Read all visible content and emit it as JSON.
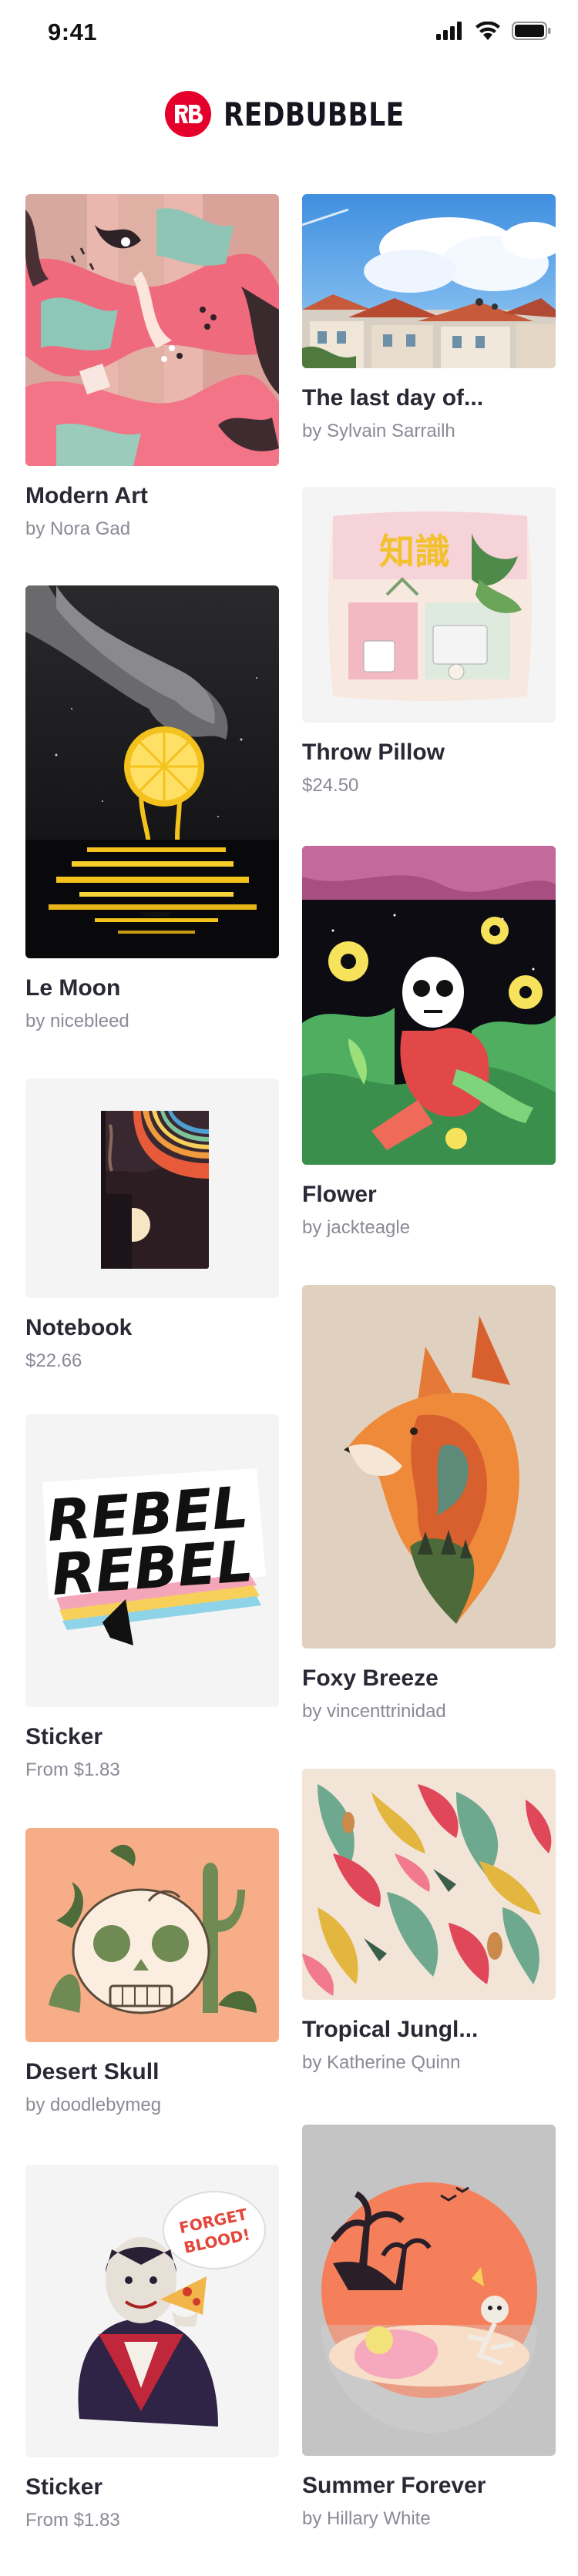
{
  "status_bar": {
    "time": "9:41"
  },
  "brand": {
    "name": "REDBUBBLE",
    "color": "#e4002b"
  },
  "cards": [
    {
      "title": "Modern Art",
      "subtitle": "by Nora Gad"
    },
    {
      "title": "The last day of...",
      "subtitle": "by Sylvain Sarrailh"
    },
    {
      "title": "Throw Pillow",
      "subtitle": "$24.50",
      "image_text": "知識"
    },
    {
      "title": "Le Moon",
      "subtitle": "by nicebleed"
    },
    {
      "title": "Flower",
      "subtitle": "by jackteagle"
    },
    {
      "title": "Notebook",
      "subtitle": "$22.66"
    },
    {
      "title": "Foxy Breeze",
      "subtitle": "by vincenttrinidad"
    },
    {
      "title": "Sticker",
      "subtitle": "From $1.83",
      "image_text": [
        "REBEL",
        "REBEL"
      ]
    },
    {
      "title": "Tropical Jungl...",
      "subtitle": "by Katherine Quinn"
    },
    {
      "title": "Desert Skull",
      "subtitle": "by doodlebymeg"
    },
    {
      "title": "Summer Forever",
      "subtitle": "by Hillary White"
    },
    {
      "title": "Sticker",
      "subtitle": "From $1.83",
      "image_text": [
        "FORGET",
        "BLOOD!"
      ]
    }
  ]
}
